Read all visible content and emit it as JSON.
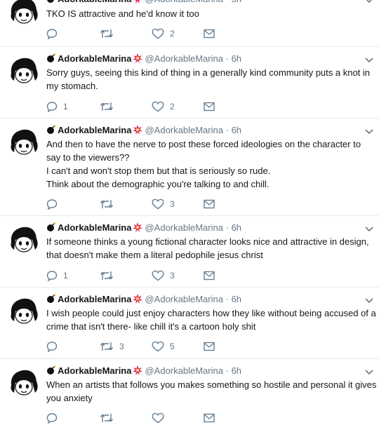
{
  "user": {
    "display_name": "AdorkableMarina",
    "handle": "@AdorkableMarina",
    "sep": "·"
  },
  "icons": {
    "avatar": "cartoon-girl-avatar",
    "name_prefix": "bomb-icon",
    "name_suffix": "burst-icon",
    "menu": "chevron-down-icon",
    "reply": "reply-icon",
    "retweet": "retweet-icon",
    "like": "heart-icon",
    "message": "envelope-icon"
  },
  "colors": {
    "text": "#14171a",
    "muted": "#657786",
    "action": "#667f94",
    "burst": "#e0245e",
    "divider": "#e6ecf0"
  },
  "tweets": [
    {
      "time": "5h",
      "lines": [
        "TKO IS attractive and he'd know it too"
      ],
      "replies": "",
      "retweets": "",
      "likes": "2"
    },
    {
      "time": "6h",
      "lines": [
        "Sorry guys, seeing this kind of thing in a generally kind community puts a knot in",
        "my stomach."
      ],
      "replies": "1",
      "retweets": "",
      "likes": "2"
    },
    {
      "time": "6h",
      "lines": [
        "And then to have the nerve to post these forced ideologies on the character to",
        "say to the viewers??",
        "I can't and won't stop them but that is seriously so rude.",
        "Think about the demographic you're talking to and chill."
      ],
      "replies": "",
      "retweets": "",
      "likes": "3"
    },
    {
      "time": "6h",
      "lines": [
        "If someone thinks a young fictional character looks nice and attractive in design,",
        "that doesn't make them a literal pedophile jesus christ"
      ],
      "replies": "1",
      "retweets": "",
      "likes": "3"
    },
    {
      "time": "6h",
      "lines": [
        "I wish people could just enjoy characters how they like without being accused of a",
        "crime that isn't there- like chill it's a cartoon holy shit"
      ],
      "replies": "",
      "retweets": "3",
      "likes": "5"
    },
    {
      "time": "6h",
      "lines": [
        "When an artists that follows you makes something so hostile and personal it gives",
        "you anxiety"
      ],
      "replies": "",
      "retweets": "",
      "likes": ""
    }
  ]
}
